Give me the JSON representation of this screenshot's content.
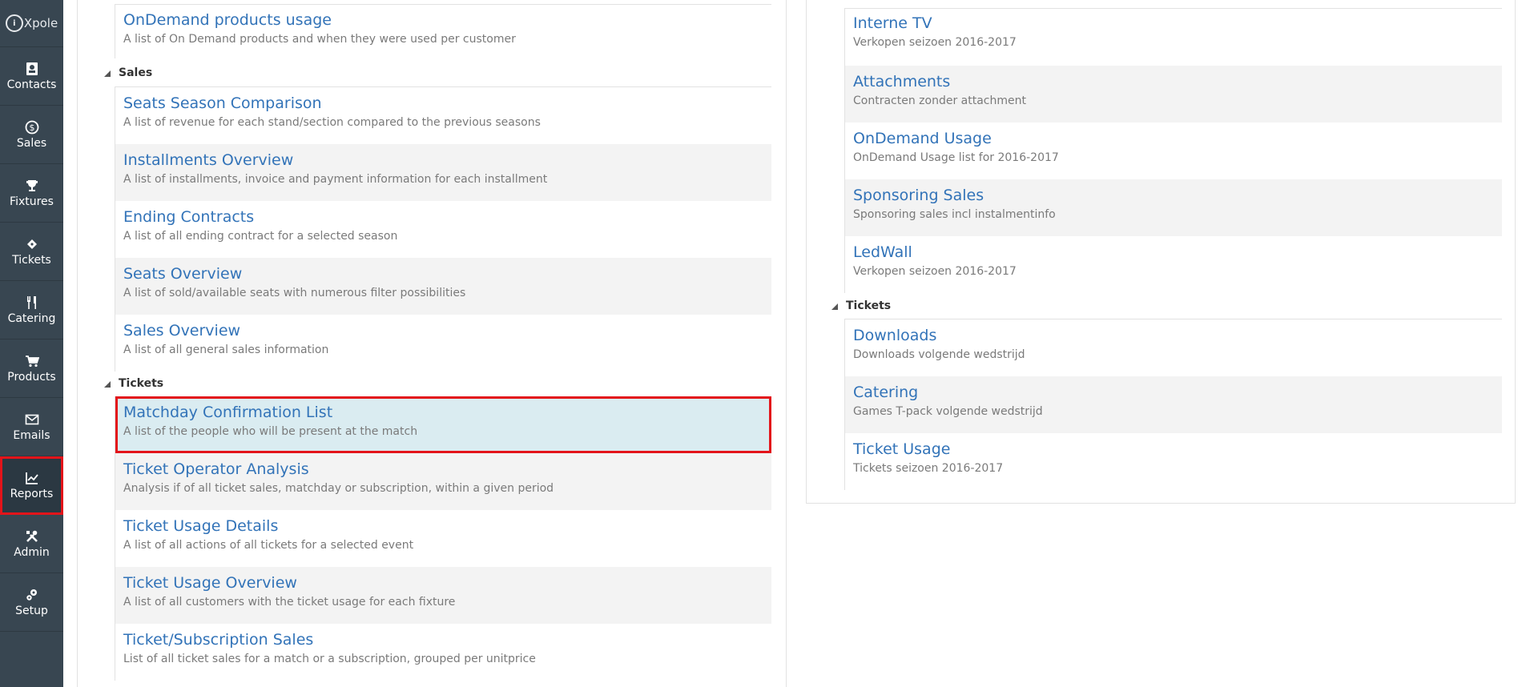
{
  "app": {
    "logo_text": "Xpole",
    "logo_initial": "i"
  },
  "sidebar": {
    "items": [
      {
        "label": "Contacts",
        "icon": "contacts-icon"
      },
      {
        "label": "Sales",
        "icon": "dollar-icon"
      },
      {
        "label": "Fixtures",
        "icon": "trophy-icon"
      },
      {
        "label": "Tickets",
        "icon": "ticket-icon"
      },
      {
        "label": "Catering",
        "icon": "cutlery-icon"
      },
      {
        "label": "Products",
        "icon": "cart-icon"
      },
      {
        "label": "Emails",
        "icon": "envelope-icon"
      },
      {
        "label": "Reports",
        "icon": "chart-icon"
      },
      {
        "label": "Admin",
        "icon": "tools-icon"
      },
      {
        "label": "Setup",
        "icon": "gears-icon"
      }
    ],
    "active": "Reports"
  },
  "left": {
    "top_item": {
      "title": "OnDemand products usage",
      "desc": "A list of On Demand products and when they were used per customer"
    },
    "sales_group": "Sales",
    "sales": [
      {
        "title": "Seats Season Comparison",
        "desc": "A list of revenue for each stand/section compared to the previous seasons"
      },
      {
        "title": "Installments Overview",
        "desc": "A list of installments, invoice and payment information for each installment"
      },
      {
        "title": "Ending Contracts",
        "desc": "A list of all ending contract for a selected season"
      },
      {
        "title": "Seats Overview",
        "desc": "A list of sold/available seats with numerous filter possibilities"
      },
      {
        "title": "Sales Overview",
        "desc": "A list of all general sales information"
      }
    ],
    "tickets_group": "Tickets",
    "tickets": [
      {
        "title": "Matchday Confirmation List",
        "desc": "A list of the people who will be present at the match"
      },
      {
        "title": "Ticket Operator Analysis",
        "desc": "Analysis if of all ticket sales, matchday or subscription, within a given period"
      },
      {
        "title": "Ticket Usage Details",
        "desc": "A list of all actions of all tickets for a selected event"
      },
      {
        "title": "Ticket Usage Overview",
        "desc": "A list of all customers with the ticket usage for each fixture"
      },
      {
        "title": "Ticket/Subscription Sales",
        "desc": "List of all ticket sales for a match or a subscription, grouped per unitprice"
      }
    ]
  },
  "right": {
    "top_items": [
      {
        "title": "Interne TV",
        "desc": "Verkopen seizoen 2016-2017"
      },
      {
        "title": "Attachments",
        "desc": "Contracten zonder attachment"
      },
      {
        "title": "OnDemand Usage",
        "desc": "OnDemand Usage list for 2016-2017"
      },
      {
        "title": "Sponsoring Sales",
        "desc": "Sponsoring sales incl instalmentinfo"
      },
      {
        "title": "LedWall",
        "desc": "Verkopen seizoen 2016-2017"
      }
    ],
    "tickets_group": "Tickets",
    "tickets": [
      {
        "title": "Downloads",
        "desc": "Downloads volgende wedstrijd"
      },
      {
        "title": "Catering",
        "desc": "Games T-pack volgende wedstrijd"
      },
      {
        "title": "Ticket Usage",
        "desc": "Tickets seizoen 2016-2017"
      }
    ]
  },
  "colors": {
    "sidebar_bg": "#384651",
    "link": "#3273b8",
    "highlight_bg": "#daecf1",
    "highlight_border": "#e3141a"
  }
}
